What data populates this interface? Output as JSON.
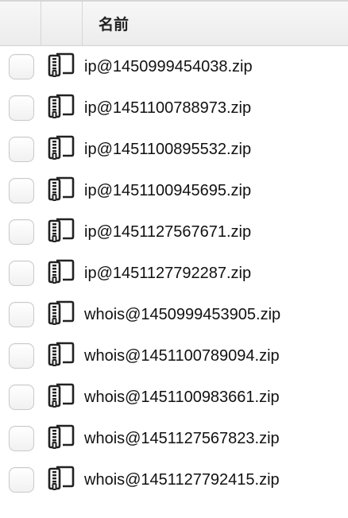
{
  "header": {
    "name_label": "名前"
  },
  "files": [
    {
      "name": "ip@1450999454038.zip",
      "icon": "zip-archive-icon"
    },
    {
      "name": "ip@1451100788973.zip",
      "icon": "zip-archive-icon"
    },
    {
      "name": "ip@1451100895532.zip",
      "icon": "zip-archive-icon"
    },
    {
      "name": "ip@1451100945695.zip",
      "icon": "zip-archive-icon"
    },
    {
      "name": "ip@1451127567671.zip",
      "icon": "zip-archive-icon"
    },
    {
      "name": "ip@1451127792287.zip",
      "icon": "zip-archive-icon"
    },
    {
      "name": "whois@1450999453905.zip",
      "icon": "zip-archive-icon"
    },
    {
      "name": "whois@1451100789094.zip",
      "icon": "zip-archive-icon"
    },
    {
      "name": "whois@1451100983661.zip",
      "icon": "zip-archive-icon"
    },
    {
      "name": "whois@1451127567823.zip",
      "icon": "zip-archive-icon"
    },
    {
      "name": "whois@1451127792415.zip",
      "icon": "zip-archive-icon"
    }
  ]
}
